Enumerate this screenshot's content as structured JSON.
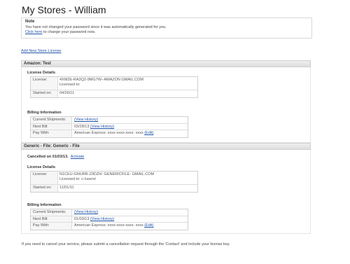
{
  "page": {
    "title": "My Stores - William"
  },
  "note": {
    "title": "Note",
    "line1": "You have not changed your password since it was automatically generated for you.",
    "line2_link": "Click here",
    "line2_rest": " to change your password now."
  },
  "add_store_link": "Add New Store License",
  "stores": [
    {
      "name": "Amazon: Test",
      "license_details_label": "License Details",
      "license_label": "License:",
      "license_value": "4XM2E-RA3Q2-9MG7W--AMAZON GMAIL.COM",
      "licensed_to": "Licensed to:",
      "started_label": "Started on:",
      "started_value": "04/26/11",
      "billing_label": "Billing Information",
      "shipments_label": "Current Shipments:",
      "shipments_link": "(View History)",
      "next_bill_label": "Next Bill:",
      "next_bill_value": "03/28/13",
      "next_bill_link": "(View History)",
      "pay_with_label": "Pay With:",
      "pay_with_value": "American Express: xxxx-xxxx-xxxx- xxxx",
      "edit_link": "(Edit)"
    },
    {
      "name": "Generic - File: Generic - File",
      "cancelled_text": "Cancelled on 01/03/13.",
      "activate_link": "Activate",
      "license_details_label": "License Details",
      "license_label": "License:",
      "license_value": "N1CEU-GNURR-Z9DZH- GENERICFILE- GMAIL.COM",
      "licensed_to": "Licensed to: c:/users/",
      "started_label": "Started on:",
      "started_value": "11/01/11",
      "billing_label": "Billing Information",
      "shipments_label": "Current Shipments:",
      "shipments_link": "(View History)",
      "next_bill_label": "Next Bill:",
      "next_bill_value": "01/03/13",
      "next_bill_link": "(View History)",
      "pay_with_label": "Pay With:",
      "pay_with_value": "American Express: xxxx-xxxx-xxxx- xxxx",
      "edit_link": "(Edit)"
    }
  ],
  "footer": "If you need to cancel your service, please submit a cancellation request through the 'Contact' and include your license key."
}
